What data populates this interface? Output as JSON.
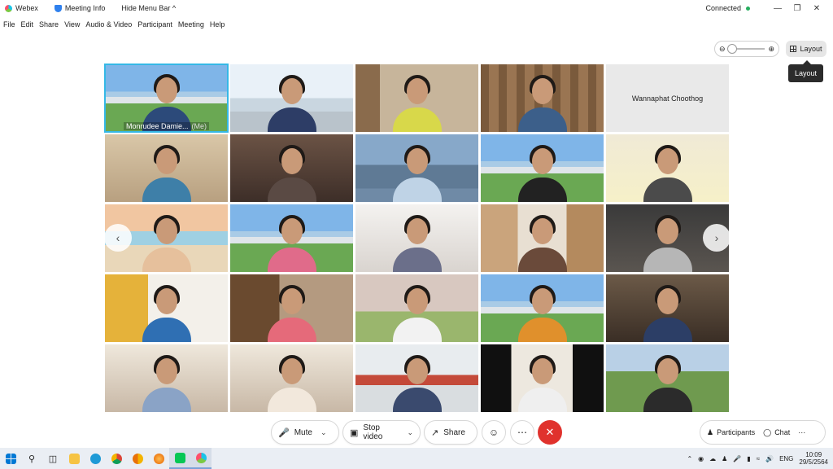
{
  "titlebar": {
    "app": "Webex",
    "meeting_info": "Meeting Info",
    "hide_menu": "Hide Menu Bar ^",
    "status": "Connected"
  },
  "menu": [
    "File",
    "Edit",
    "Share",
    "View",
    "Audio & Video",
    "Participant",
    "Meeting",
    "Help"
  ],
  "toolbar": {
    "layout_label": "Layout",
    "tooltip": "Layout"
  },
  "tiles": [
    {
      "name": "Monrudee Damie...",
      "me": "(Me)",
      "bg": "bg-building",
      "shirt": "#2c4a7a"
    },
    {
      "bg": "bg-building2",
      "shirt": "#2d3d66"
    },
    {
      "bg": "bg-books",
      "shirt": "#d8d84a"
    },
    {
      "bg": "bg-wood",
      "shirt": "#3c5f8a"
    },
    {
      "label": "Wannaphat Choothog"
    },
    {
      "bg": "bg-warm",
      "shirt": "#3e7fa8"
    },
    {
      "bg": "bg-room",
      "shirt": "#5a4a44"
    },
    {
      "bg": "bg-city",
      "shirt": "#bfd3e6"
    },
    {
      "bg": "bg-building",
      "shirt": "#222222"
    },
    {
      "bg": "bg-yellow",
      "shirt": "#4b4b4b"
    },
    {
      "bg": "bg-beach",
      "shirt": "#e6c09c"
    },
    {
      "bg": "bg-building",
      "shirt": "#e06b8a"
    },
    {
      "bg": "bg-white",
      "shirt": "#6b6f8a"
    },
    {
      "bg": "bg-window",
      "shirt": "#6a4a3a"
    },
    {
      "bg": "bg-party",
      "shirt": "#b6b6b6"
    },
    {
      "bg": "bg-curtain",
      "shirt": "#2f6fb3"
    },
    {
      "bg": "bg-closet",
      "shirt": "#e56a7a"
    },
    {
      "bg": "bg-castle",
      "shirt": "#f2f2f2"
    },
    {
      "bg": "bg-building",
      "shirt": "#e0902c"
    },
    {
      "bg": "bg-dim",
      "shirt": "#2c3e66"
    },
    {
      "bg": "bg-kid",
      "shirt": "#8aa3c6"
    },
    {
      "bg": "bg-kid",
      "shirt": "#f2e8dc"
    },
    {
      "bg": "bg-class",
      "shirt": "#3a4a6e"
    },
    {
      "bg": "bg-black",
      "shirt": "#efefef"
    },
    {
      "bg": "bg-field",
      "shirt": "#2b2b2b"
    }
  ],
  "controls": {
    "mute": "Mute",
    "stop_video": "Stop video",
    "share": "Share",
    "participants": "Participants",
    "chat": "Chat"
  },
  "taskbar": {
    "lang": "ENG",
    "time": "10:09",
    "date": "29/5/2564"
  }
}
